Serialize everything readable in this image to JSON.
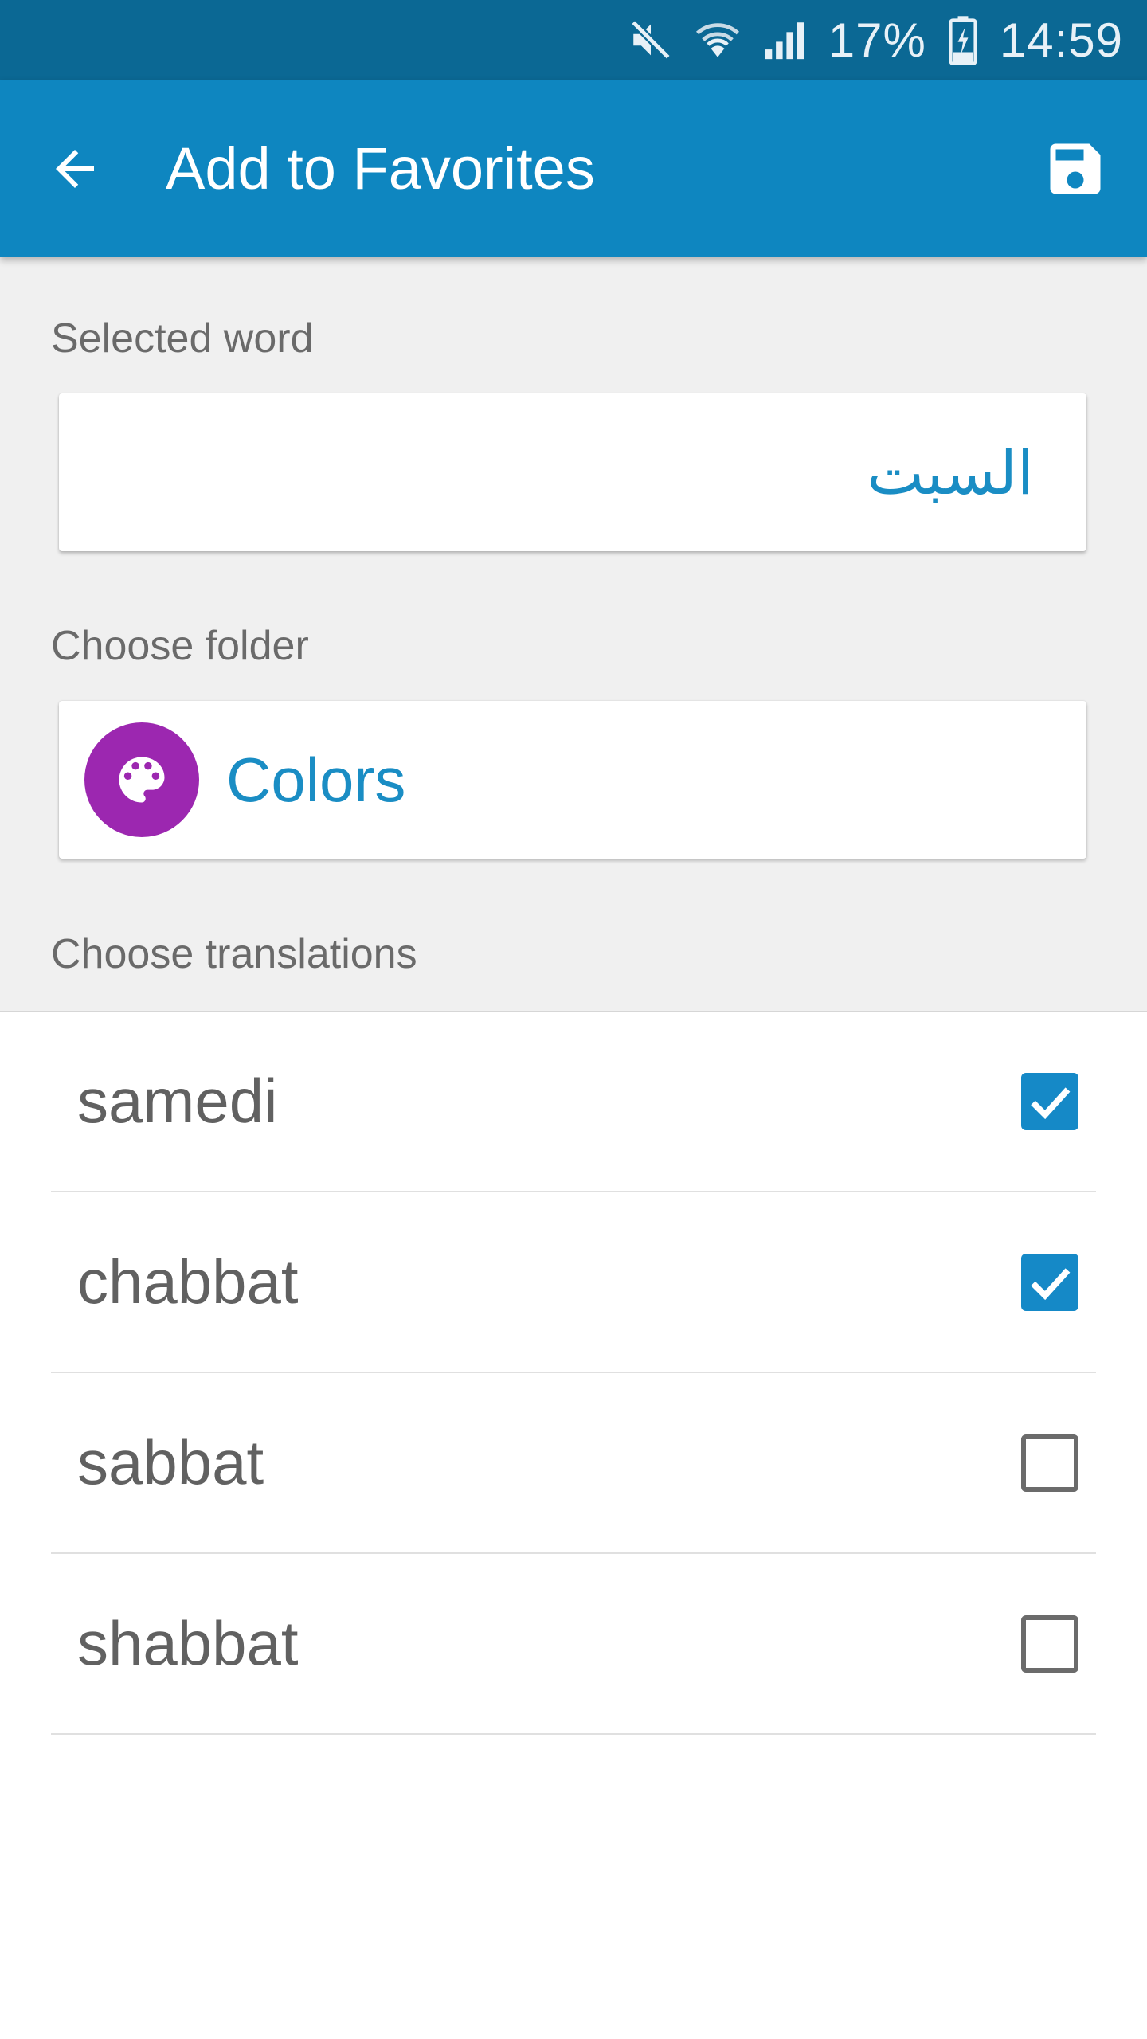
{
  "status_bar": {
    "battery": "17%",
    "time": "14:59",
    "icons": [
      "mute-icon",
      "wifi-icon",
      "signal-icon",
      "battery-charging-icon"
    ]
  },
  "app_bar": {
    "title": "Add to Favorites",
    "back_icon": "arrow-back-icon",
    "save_icon": "save-icon",
    "color": "#0e86c0"
  },
  "selected_word": {
    "label": "Selected word",
    "value": "السبت"
  },
  "folder": {
    "label": "Choose folder",
    "name": "Colors",
    "icon": "palette-icon",
    "icon_color": "#9c27b0"
  },
  "translations": {
    "label": "Choose translations",
    "items": [
      {
        "text": "samedi",
        "checked": true
      },
      {
        "text": "chabbat",
        "checked": true
      },
      {
        "text": "sabbat",
        "checked": false
      },
      {
        "text": "shabbat",
        "checked": false
      }
    ]
  }
}
